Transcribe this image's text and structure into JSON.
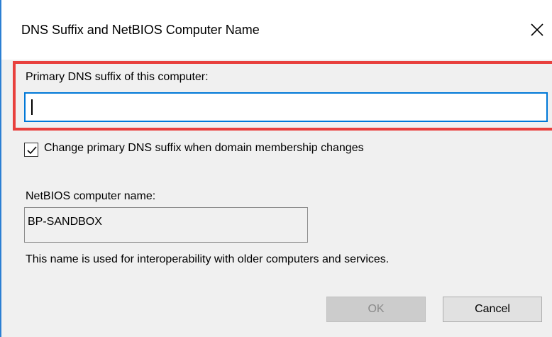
{
  "window": {
    "title": "DNS Suffix and NetBIOS Computer Name"
  },
  "primary_dns": {
    "label": "Primary DNS suffix of this computer:",
    "value": ""
  },
  "change_suffix_checkbox": {
    "checked": true,
    "label": "Change primary DNS suffix when domain membership changes"
  },
  "netbios": {
    "label": "NetBIOS computer name:",
    "value": "BP-SANDBOX"
  },
  "info_text": "This name is used for interoperability with older computers and services.",
  "buttons": {
    "ok": "OK",
    "cancel": "Cancel"
  },
  "colors": {
    "accent": "#0078d7",
    "highlight_border": "#e8403d",
    "dialog_background": "#f0f0f0"
  },
  "icons": {
    "close": "close-icon",
    "check": "check-icon"
  }
}
